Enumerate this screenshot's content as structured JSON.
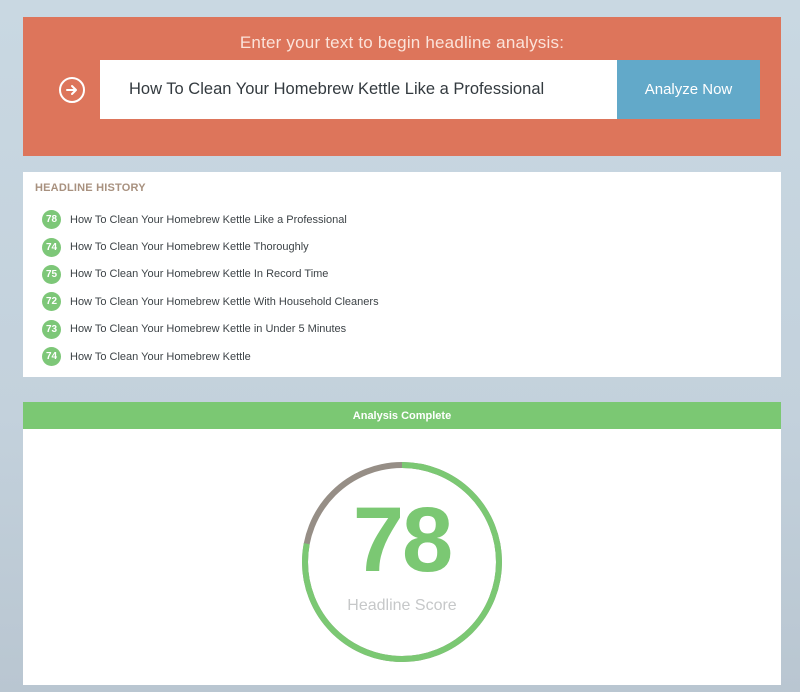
{
  "input_panel": {
    "prompt": "Enter your text to begin headline analysis:",
    "headline_value": "How To Clean Your Homebrew Kettle Like a Professional",
    "analyze_label": "Analyze Now",
    "arrow_icon": "arrow-right-circle-icon",
    "background_color": "#dd755b",
    "button_color": "#62a9c9"
  },
  "history": {
    "heading": "HEADLINE HISTORY",
    "items": [
      {
        "score": "78",
        "headline": "How To Clean Your Homebrew Kettle Like a Professional"
      },
      {
        "score": "74",
        "headline": "How To Clean Your Homebrew Kettle Thoroughly"
      },
      {
        "score": "75",
        "headline": "How To Clean Your Homebrew Kettle In Record Time"
      },
      {
        "score": "72",
        "headline": "How To Clean Your Homebrew Kettle With Household Cleaners"
      },
      {
        "score": "73",
        "headline": "How To Clean Your Homebrew Kettle in Under 5 Minutes"
      },
      {
        "score": "74",
        "headline": "How To Clean Your Homebrew Kettle"
      }
    ],
    "badge_color": "#7dc778"
  },
  "analysis": {
    "banner": "Analysis Complete",
    "score": 78,
    "score_text": "78",
    "score_label": "Headline Score",
    "score_max": 100,
    "ring_color": "#7bc873",
    "ring_remainder_color": "#968e86"
  }
}
